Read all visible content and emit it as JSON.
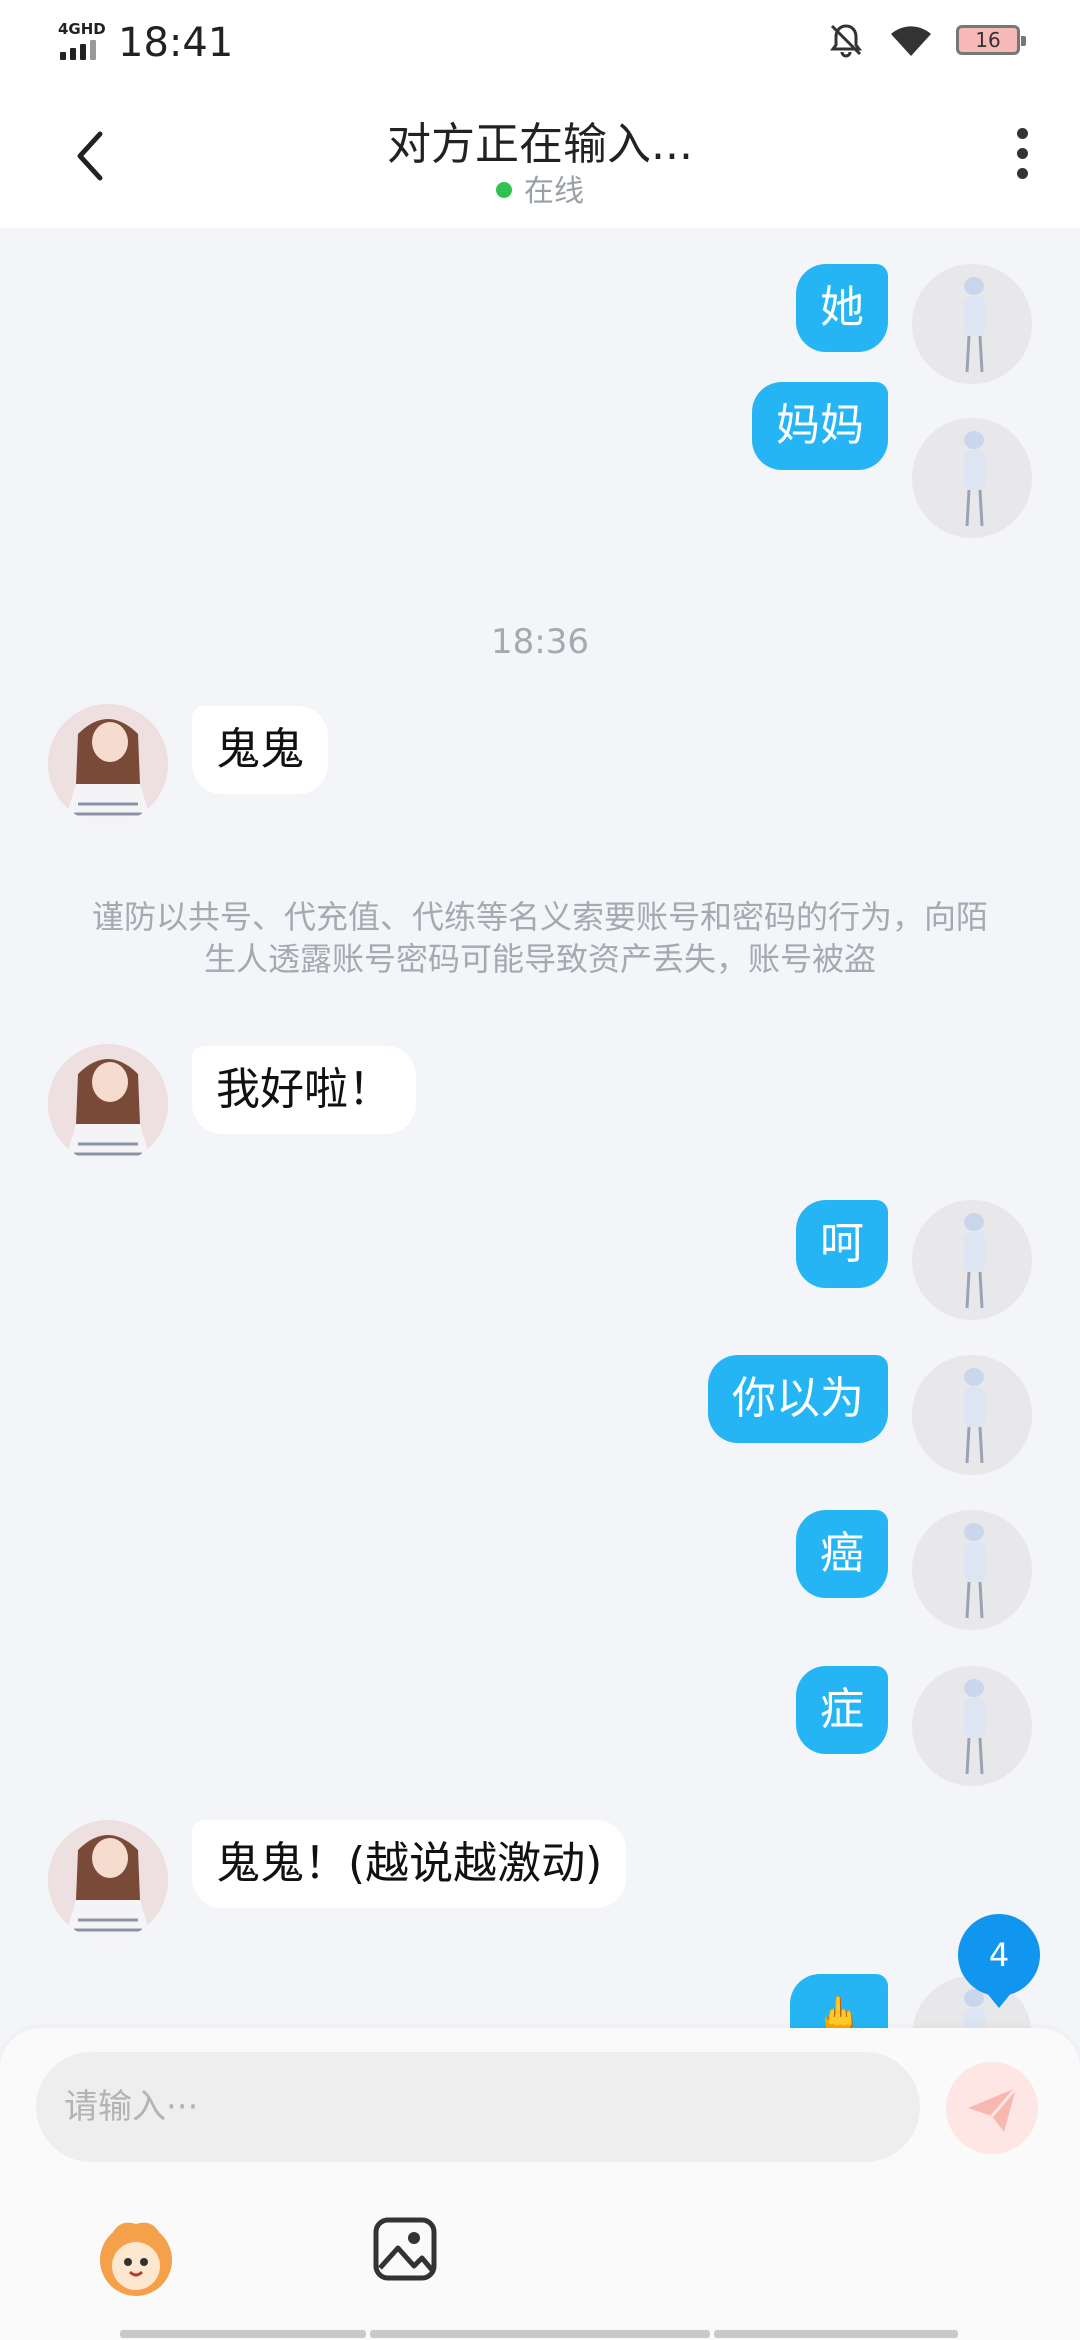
{
  "status_bar": {
    "network": "4GHD",
    "time": "18:41",
    "battery": "16"
  },
  "header": {
    "title": "对方正在输入...",
    "status": "在线"
  },
  "messages": [
    {
      "side": "me",
      "text": "她"
    },
    {
      "side": "me",
      "text": "妈妈"
    },
    {
      "type": "timestamp",
      "text": "18:36"
    },
    {
      "side": "them",
      "text": "鬼鬼"
    },
    {
      "type": "notice",
      "text": "谨防以共号、代充值、代练等名义索要账号和密码的行为，向陌生人透露账号密码可能导致资产丢失，账号被盗"
    },
    {
      "side": "them",
      "text": "我好啦！"
    },
    {
      "side": "me",
      "text": "呵"
    },
    {
      "side": "me",
      "text": "你以为"
    },
    {
      "side": "me",
      "text": "癌"
    },
    {
      "side": "me",
      "text": "症"
    },
    {
      "side": "them",
      "text": "鬼鬼！(越说越激动)"
    },
    {
      "side": "me",
      "text": "🖕"
    }
  ],
  "unread_badge": "4",
  "composer": {
    "placeholder": "请输入···"
  },
  "colors": {
    "accent": "#25b5f5",
    "online": "#2fc24f",
    "badge": "#1196ef"
  }
}
